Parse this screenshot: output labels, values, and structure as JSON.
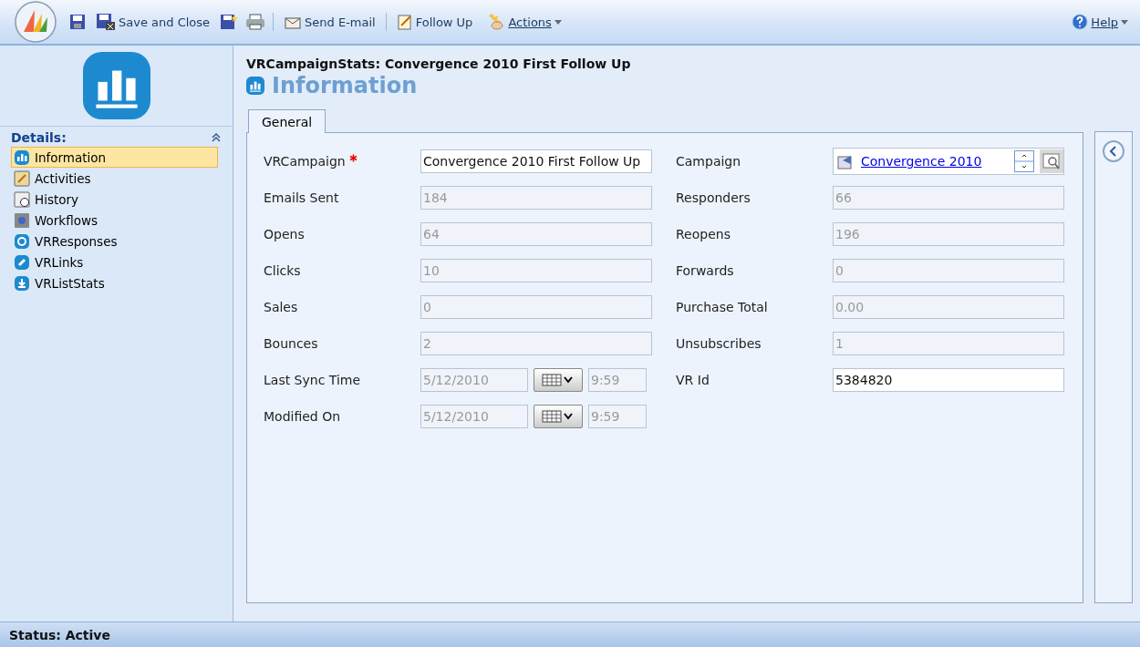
{
  "toolbar": {
    "items": [
      {
        "kind": "button",
        "label": "Save and Close"
      },
      {
        "kind": "button",
        "label": "Send E-mail"
      },
      {
        "kind": "button",
        "label": "Follow Up"
      },
      {
        "kind": "menu",
        "label": "Actions"
      }
    ],
    "help": "Help"
  },
  "header": {
    "entity": "VRCampaignStats: Convergence 2010 First Follow Up",
    "title": "Information"
  },
  "sidebar": {
    "heading": "Details:",
    "items": [
      {
        "label": "Information",
        "selected": true
      },
      {
        "label": "Activities",
        "selected": false
      },
      {
        "label": "History",
        "selected": false
      },
      {
        "label": "Workflows",
        "selected": false
      },
      {
        "label": "VRResponses",
        "selected": false
      },
      {
        "label": "VRLinks",
        "selected": false
      },
      {
        "label": "VRListStats",
        "selected": false
      }
    ]
  },
  "tabs": [
    {
      "label": "General",
      "selected": true
    }
  ],
  "columns": [
    [
      {
        "kind": "text",
        "label": "VRCampaign",
        "required": true,
        "value": "Convergence 2010 First Follow Up",
        "disabled": false
      },
      {
        "kind": "text",
        "label": "Emails Sent",
        "required": false,
        "value": "184",
        "disabled": true
      },
      {
        "kind": "text",
        "label": "Opens",
        "required": false,
        "value": "64",
        "disabled": true
      },
      {
        "kind": "text",
        "label": "Clicks",
        "required": false,
        "value": "10",
        "disabled": true
      },
      {
        "kind": "text",
        "label": "Sales",
        "required": false,
        "value": "0",
        "disabled": true
      },
      {
        "kind": "text",
        "label": "Bounces",
        "required": false,
        "value": "2",
        "disabled": true
      },
      {
        "kind": "datetime",
        "label": "Last Sync Time",
        "required": false,
        "value": "5/12/2010",
        "time": "9:59",
        "disabled": true
      },
      {
        "kind": "datetime",
        "label": "Modified On",
        "required": false,
        "value": "5/12/2010",
        "time": "9:59",
        "disabled": true
      }
    ],
    [
      {
        "kind": "lookup",
        "label": "Campaign",
        "required": false,
        "value": "Convergence 2010",
        "disabled": false
      },
      {
        "kind": "text",
        "label": "Responders",
        "required": false,
        "value": "66",
        "disabled": true
      },
      {
        "kind": "text",
        "label": "Reopens",
        "required": false,
        "value": "196",
        "disabled": true
      },
      {
        "kind": "text",
        "label": "Forwards",
        "required": false,
        "value": "0",
        "disabled": true
      },
      {
        "kind": "text",
        "label": "Purchase Total",
        "required": false,
        "value": "0.00",
        "disabled": true
      },
      {
        "kind": "text",
        "label": "Unsubscribes",
        "required": false,
        "value": "1",
        "disabled": true
      },
      {
        "kind": "text",
        "label": "VR Id",
        "required": false,
        "value": "5384820",
        "disabled": false
      }
    ]
  ],
  "status_bar": "Status: Active"
}
